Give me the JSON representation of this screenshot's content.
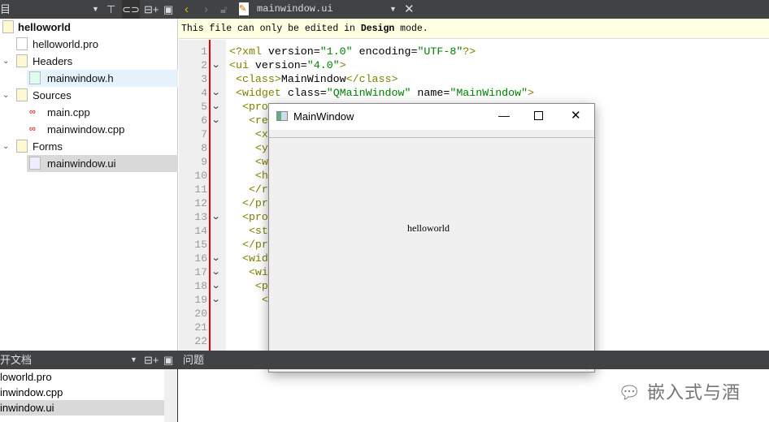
{
  "toolbar": {
    "left_label": "目",
    "file_name": "mainwindow.ui",
    "icons": [
      "chevron-down-icon",
      "filter-icon",
      "link-icon",
      "split-add-icon",
      "close-pane-icon",
      "back-icon",
      "forward-icon",
      "lock-icon",
      "ui-file-icon",
      "close-icon"
    ]
  },
  "project_tree": {
    "items": [
      {
        "label": "helloworld",
        "icon": "qt-project-icon",
        "selected": false
      },
      {
        "label": "helloworld.pro",
        "icon": "qt-pro-file-icon"
      },
      {
        "label": "Headers",
        "icon": "headers-folder-icon",
        "expanded": true
      },
      {
        "label": "mainwindow.h",
        "icon": "header-file-icon",
        "hovered": true
      },
      {
        "label": "Sources",
        "icon": "sources-folder-icon",
        "expanded": true
      },
      {
        "label": "main.cpp",
        "icon": "cpp-file-icon"
      },
      {
        "label": "mainwindow.cpp",
        "icon": "cpp-file-icon"
      },
      {
        "label": "Forms",
        "icon": "forms-folder-icon",
        "expanded": true
      },
      {
        "label": "mainwindow.ui",
        "icon": "ui-file-icon",
        "selected": true
      }
    ]
  },
  "info_bar": {
    "pre": "This file can only be edited in ",
    "bold": "Design",
    "post": " mode."
  },
  "editor": {
    "line_numbers": [
      "1",
      "2",
      "3",
      "4",
      "5",
      "6",
      "7",
      "8",
      "9",
      "10",
      "11",
      "12",
      "13",
      "14",
      "15",
      "16",
      "17",
      "18",
      "19",
      "20",
      "21",
      "22"
    ],
    "lines": [
      {
        "t": "<?xml ",
        "a": "version=",
        "v": "\"1.0\"",
        "a2": " encoding=",
        "v2": "\"UTF-8\"",
        "e": "?>"
      },
      {
        "t": "<ui ",
        "a": "version=",
        "v": "\"4.0\"",
        "e": ">"
      },
      {
        "t": " <class>",
        "a": "MainWindow",
        "e": "</class>"
      },
      {
        "t": " <widget ",
        "a": "class=",
        "v": "\"QMainWindow\"",
        "a2": " name=",
        "v2": "\"MainWindow\"",
        "e": ">"
      },
      {
        "t": "  <pro"
      },
      {
        "t": "   <re"
      },
      {
        "t": "    <x"
      },
      {
        "t": "    <y"
      },
      {
        "t": "    <w"
      },
      {
        "t": "    <h"
      },
      {
        "t": "   </r"
      },
      {
        "t": "  </pr"
      },
      {
        "t": "  <pro"
      },
      {
        "t": "   <st"
      },
      {
        "t": "  </pr"
      },
      {
        "t": "  <wid"
      },
      {
        "t": "   <wi"
      },
      {
        "t": "    <p"
      },
      {
        "t": "     <"
      },
      {
        "t": ""
      },
      {
        "t": ""
      },
      {
        "t": ""
      }
    ],
    "fold_lines": [
      2,
      4,
      5,
      6,
      13,
      16,
      17,
      18,
      19
    ]
  },
  "preview_window": {
    "title": "MainWindow",
    "label": "helloworld"
  },
  "bottom": {
    "open_docs_title": "开文档",
    "issues_title": "问题",
    "open_docs": [
      "loworld.pro",
      "inwindow.cpp",
      "inwindow.ui"
    ]
  },
  "watermark": "嵌入式与酒",
  "colors": {
    "toolbar": "#404244",
    "info": "#ffffe1",
    "tag": "#808000",
    "value": "#008000",
    "marker": "#e00000"
  }
}
